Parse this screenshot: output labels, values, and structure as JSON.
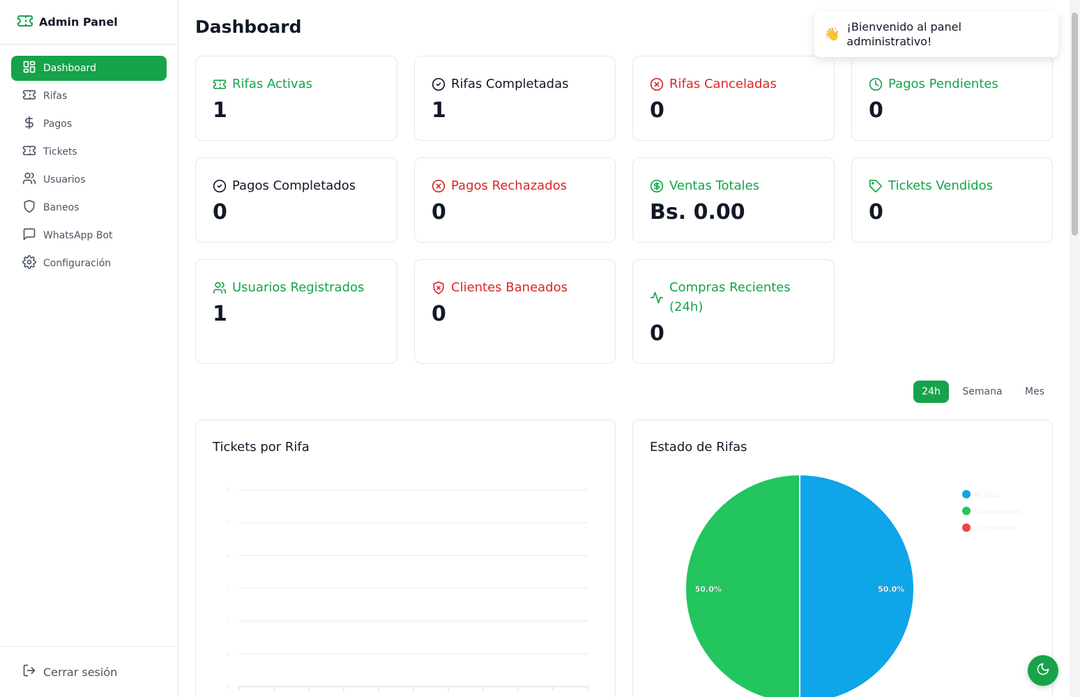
{
  "sidebar": {
    "brand": "Admin Panel",
    "items": [
      {
        "label": "Dashboard",
        "icon": "layout-dashboard-icon",
        "active": true
      },
      {
        "label": "Rifas",
        "icon": "ticket-icon"
      },
      {
        "label": "Pagos",
        "icon": "dollar-icon"
      },
      {
        "label": "Tickets",
        "icon": "ticket-icon"
      },
      {
        "label": "Usuarios",
        "icon": "users-icon"
      },
      {
        "label": "Baneos",
        "icon": "shield-icon"
      },
      {
        "label": "WhatsApp Bot",
        "icon": "message-square-icon"
      },
      {
        "label": "Configuración",
        "icon": "gear-icon"
      }
    ],
    "logout": "Cerrar sesión"
  },
  "header": {
    "title": "Dashboard"
  },
  "stats": [
    {
      "label": "Rifas Activas",
      "value": "1",
      "icon": "ticket-icon",
      "color": "#16a34a"
    },
    {
      "label": "Rifas Completadas",
      "value": "1",
      "icon": "check-circle-icon",
      "color": "#111827"
    },
    {
      "label": "Rifas Canceladas",
      "value": "0",
      "icon": "x-circle-icon",
      "color": "#dc2626"
    },
    {
      "label": "Pagos Pendientes",
      "value": "0",
      "icon": "clock-icon",
      "color": "#16a34a"
    },
    {
      "label": "Pagos Completados",
      "value": "0",
      "icon": "check-circle-icon",
      "color": "#111827"
    },
    {
      "label": "Pagos Rechazados",
      "value": "0",
      "icon": "x-circle-icon",
      "color": "#dc2626"
    },
    {
      "label": "Ventas Totales",
      "value": "Bs. 0.00",
      "icon": "dollar-circle-icon",
      "color": "#16a34a"
    },
    {
      "label": "Tickets Vendidos",
      "value": "0",
      "icon": "tag-icon",
      "color": "#16a34a"
    },
    {
      "label": "Usuarios Registrados",
      "value": "1",
      "icon": "users-icon",
      "color": "#16a34a"
    },
    {
      "label": "Clientes Baneados",
      "value": "0",
      "icon": "shield-x-icon",
      "color": "#dc2626"
    },
    {
      "label": "Compras Recientes",
      "label2": "(24h)",
      "value": "0",
      "icon": "activity-icon",
      "color": "#16a34a"
    }
  ],
  "ranges": [
    "24h",
    "Semana",
    "Mes"
  ],
  "active_range": "24h",
  "toast": {
    "icon": "👋",
    "text": "¡Bienvenido al panel administrativo!"
  },
  "chart_data": [
    {
      "type": "bar",
      "title": "Tickets por Rifa",
      "categories": [],
      "values": [],
      "yticks": [
        "0",
        "1",
        "2",
        "3",
        "4",
        "5",
        "6"
      ],
      "ylim": [
        0,
        6
      ],
      "grid": true
    },
    {
      "type": "pie",
      "title": "Estado de Rifas",
      "labels": [
        "Activas",
        "Completadas",
        "Canceladas"
      ],
      "values": [
        1,
        1,
        0
      ],
      "percent_labels": [
        "50.0%",
        "50.0%"
      ],
      "colors": [
        "#0ea5e9",
        "#22c55e",
        "#ef4444"
      ],
      "legend": "top-right"
    }
  ]
}
